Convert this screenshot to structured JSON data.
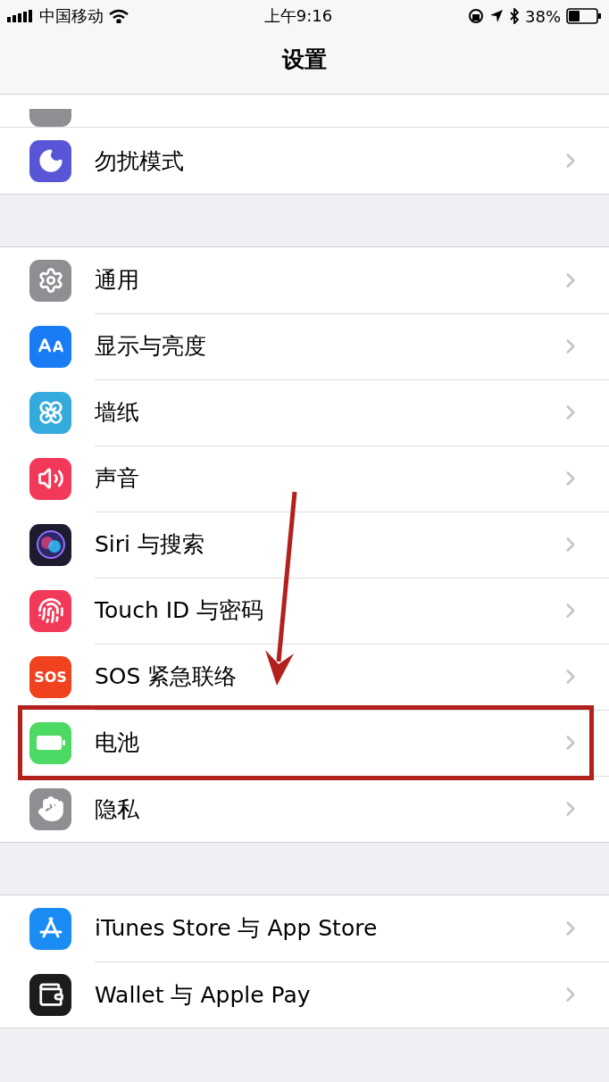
{
  "status_bar": {
    "carrier": "中国移动",
    "time": "上午9:16",
    "battery": "38%"
  },
  "nav": {
    "title": "设置"
  },
  "groups": [
    {
      "rows": [
        {
          "label": "勿扰模式",
          "color": "#5856d6",
          "highlighted": false
        }
      ]
    },
    {
      "rows": [
        {
          "label": "通用",
          "color": "#8e8e93",
          "highlighted": false
        },
        {
          "label": "显示与亮度",
          "color": "#1a7cf5",
          "highlighted": false
        },
        {
          "label": "墙纸",
          "color": "#35aadc",
          "highlighted": false
        },
        {
          "label": "声音",
          "color": "#f2395a",
          "highlighted": false
        },
        {
          "label": "Siri 与搜索",
          "color": "#1c1c2e",
          "highlighted": false
        },
        {
          "label": "Touch ID 与密码",
          "color": "#f2395a",
          "highlighted": false
        },
        {
          "label": "SOS 紧急联络",
          "color": "#f0421e",
          "icon_text": "SOS",
          "highlighted": false
        },
        {
          "label": "电池",
          "color": "#4cd964",
          "highlighted": true
        },
        {
          "label": "隐私",
          "color": "#8e8e93",
          "highlighted": false
        }
      ]
    },
    {
      "rows": [
        {
          "label": "iTunes Store 与 App Store",
          "color": "#1c8cf5",
          "highlighted": false
        },
        {
          "label": "Wallet 与 Apple Pay",
          "color": "#1c1c1e",
          "highlighted": false
        }
      ]
    }
  ]
}
